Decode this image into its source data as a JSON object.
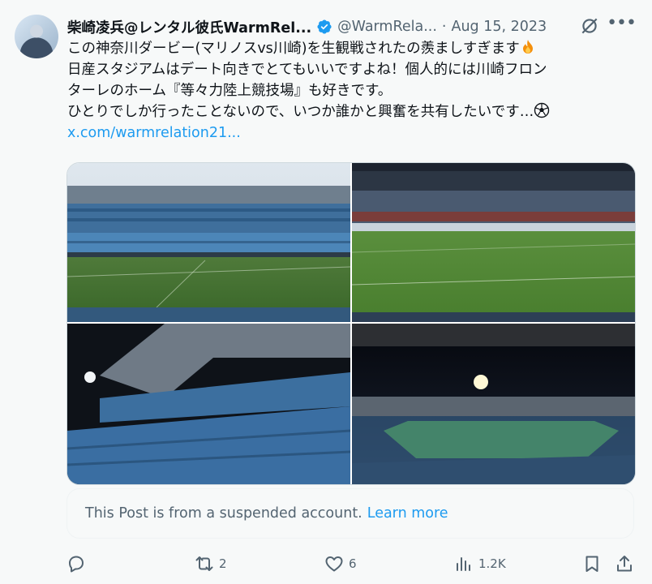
{
  "author": {
    "name": "柴崎凌兵@レンタル彼氏WarmRel...",
    "handle": "@WarmRela...",
    "separator": "·",
    "date": "Aug 15, 2023"
  },
  "body_lines": [
    "この神奈川ダービー(マリノスvs川崎)を生観戦されたの羨ましすぎます",
    "日産スタジアムはデート向きでとてもいいですよね！個人的には川崎フロン",
    "ターレのホーム『等々力陸上競技場』も好きです。",
    "ひとりでしか行ったことないので、いつか誰かと興奮を共有したいです…"
  ],
  "link_text": "x.com/warmrelation21...",
  "notice": {
    "text": "This Post is from a suspended account.",
    "link": "Learn more"
  },
  "actions": {
    "reply": "",
    "retweet": "2",
    "like": "6",
    "views": "1.2K"
  },
  "icons": {
    "verified": "verified-badge-icon",
    "grok": "grok-icon",
    "more": "more-icon",
    "reply": "reply-icon",
    "retweet": "retweet-icon",
    "like": "heart-icon",
    "views": "views-icon",
    "bookmark": "bookmark-icon",
    "share": "share-icon"
  },
  "colors": {
    "accent": "#1d9bf0",
    "secondary_text": "#536471",
    "primary_text": "#0f1419"
  }
}
